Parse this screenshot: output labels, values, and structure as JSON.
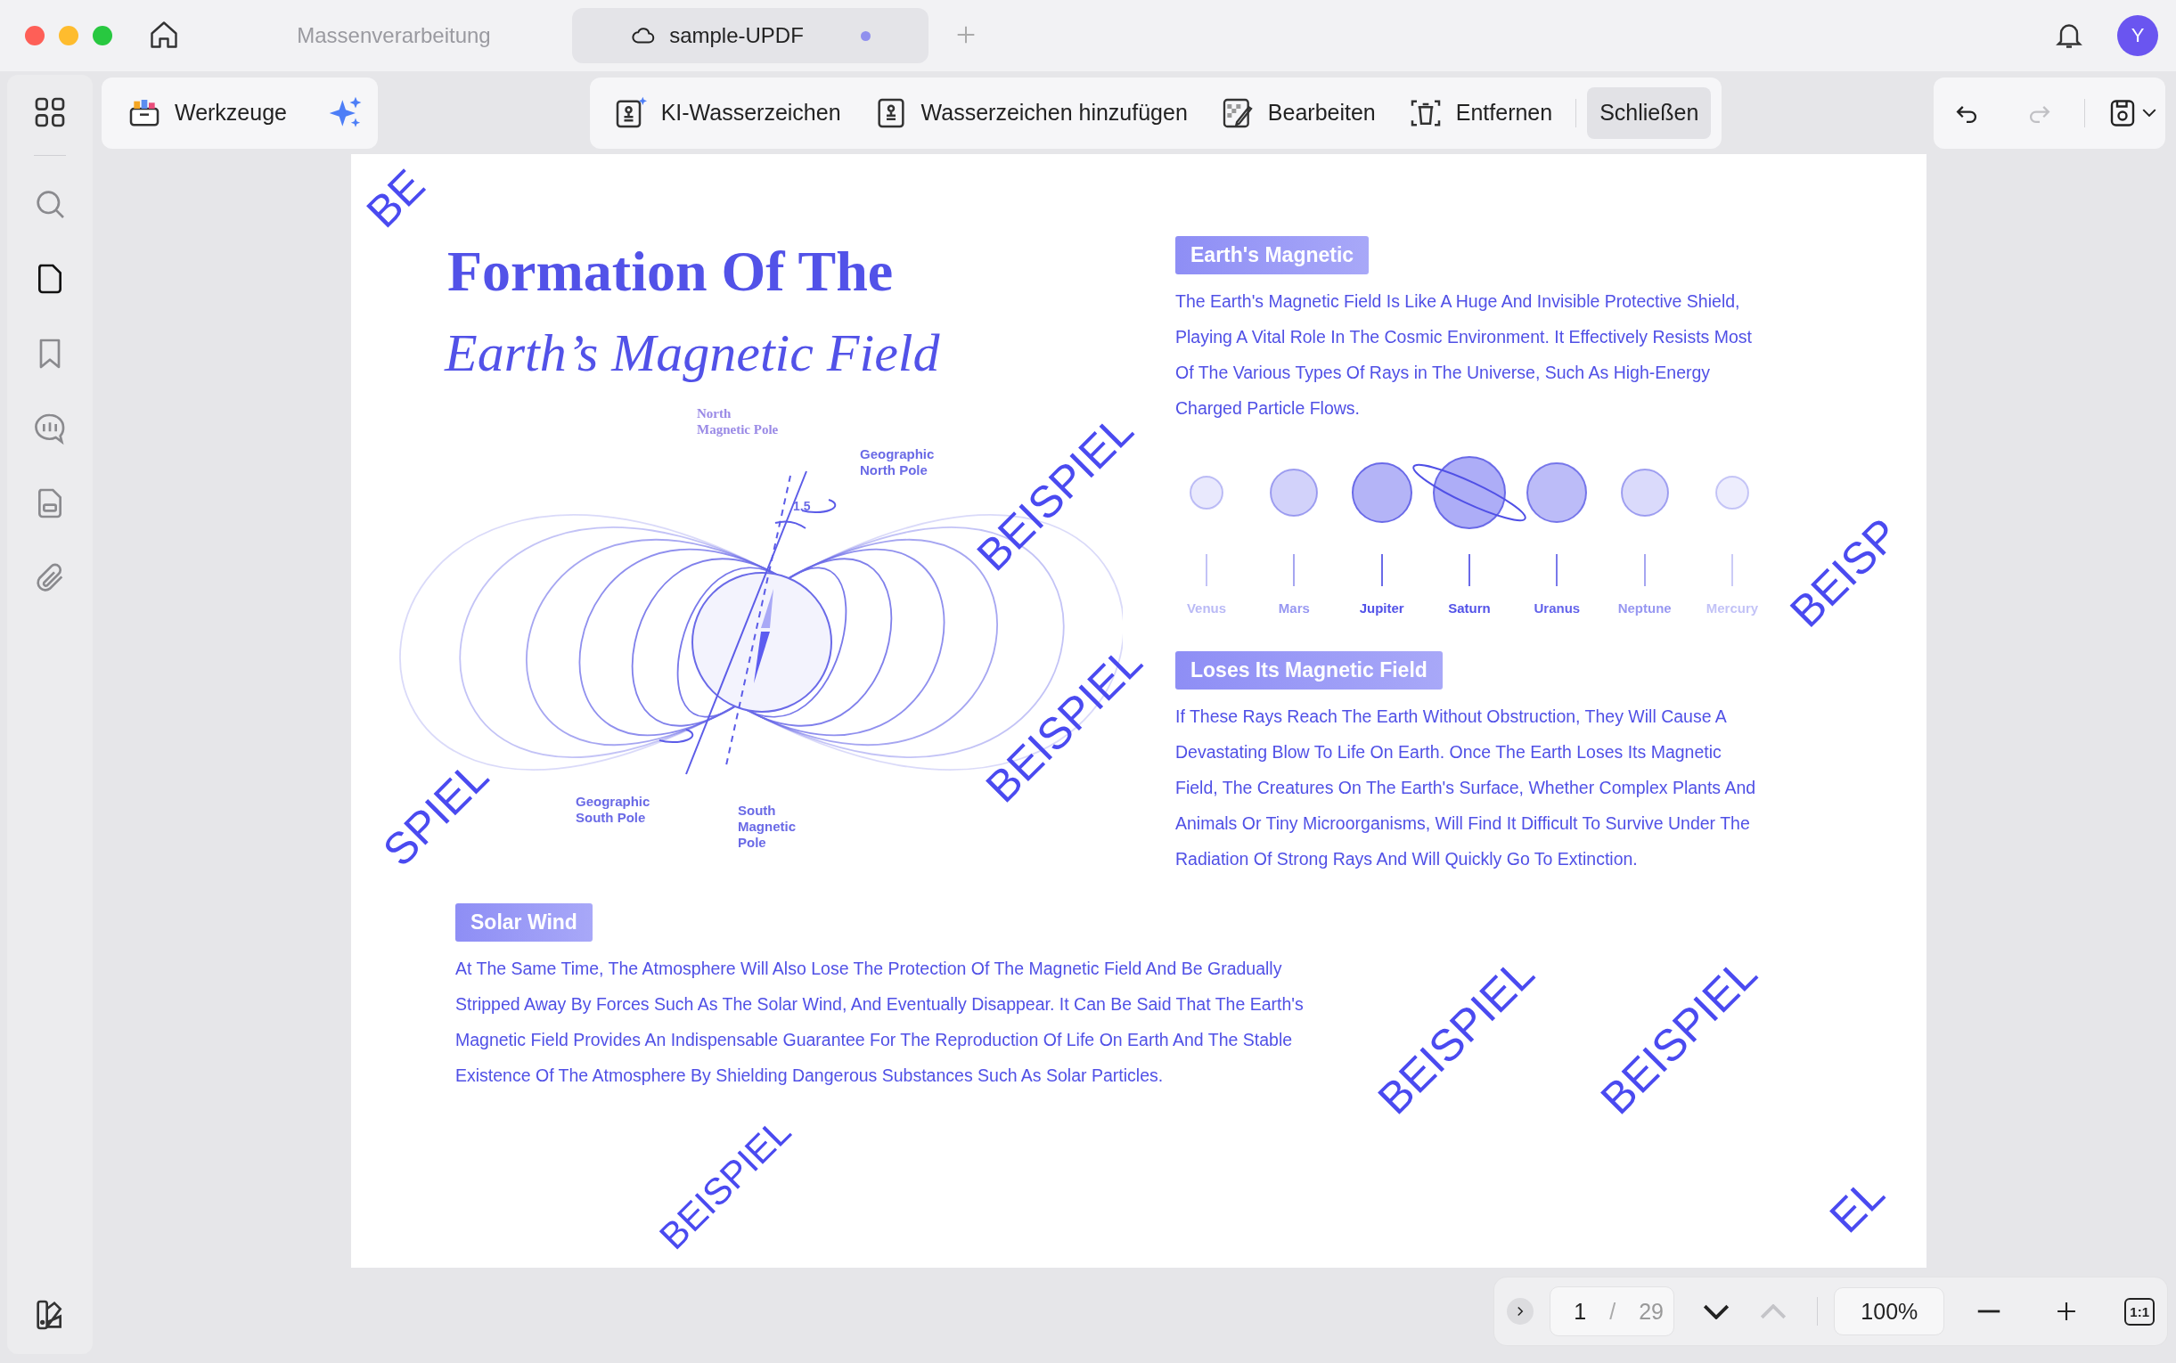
{
  "tabs": [
    {
      "label": "Massenverarbeitung",
      "selected": false,
      "modified": false
    },
    {
      "label": "sample-UPDF",
      "selected": true,
      "modified": true
    }
  ],
  "avatar": "Y",
  "tools": {
    "label": "Werkzeuge"
  },
  "watermark_toolbar": [
    {
      "label": "KI-Wasserzeichen",
      "selected": false
    },
    {
      "label": "Wasserzeichen hinzufügen",
      "selected": false
    },
    {
      "label": "Bearbeiten",
      "selected": false
    },
    {
      "label": "Entfernen",
      "selected": false
    },
    {
      "label": "Schließen",
      "selected": true
    }
  ],
  "history": {
    "undo_disabled": false,
    "redo_disabled": true
  },
  "sidebar": [
    {
      "selected": false
    },
    {
      "selected": true
    },
    {
      "selected": false
    },
    {
      "selected": false
    },
    {
      "selected": false
    },
    {
      "selected": false
    }
  ],
  "document": {
    "title_line1": "Formation Of The",
    "title_line2": "Earth’s Magnetic Field",
    "diagram_labels": {
      "north_magnetic_pole": "North Magnetic Pole",
      "geographic_north_pole": "Geographic North Pole",
      "angle": "1.5",
      "geographic_south_pole": "Geographic South Pole",
      "south_magnetic_pole": "South Magnetic Pole"
    },
    "sections": [
      {
        "heading": "Earth's Magnetic",
        "text": "The Earth's Magnetic Field Is Like A Huge And Invisible Protective Shield, Playing A Vital Role In The Cosmic Environment. It Effectively Resists Most Of The Various Types Of Rays in The Universe, Such As High-Energy Charged Particle Flows."
      },
      {
        "heading": "Loses Its Magnetic Field",
        "text": "If These Rays Reach The Earth Without Obstruction, They Will Cause A Devastating Blow To Life On Earth. Once The Earth Loses Its Magnetic Field, The Creatures On The Earth's Surface, Whether Complex Plants And Animals Or Tiny Microorganisms, Will Find It Difficult To Survive Under The Radiation Of Strong Rays And Will Quickly Go To Extinction."
      },
      {
        "heading": "Solar Wind",
        "text": "At The Same Time, The Atmosphere Will Also Lose The Protection Of The Magnetic Field And Be Gradually Stripped Away By Forces Such As The Solar Wind, And Eventually Disappear. It Can Be Said That The Earth's Magnetic Field Provides An Indispensable Guarantee For The Reproduction Of Life On Earth And The Stable Existence Of The Atmosphere By Shielding Dangerous Substances Such As Solar Particles."
      }
    ],
    "planets": [
      {
        "name": "Venus",
        "kind": "plain"
      },
      {
        "name": "Mars",
        "kind": "plain"
      },
      {
        "name": "Jupiter",
        "kind": "plain"
      },
      {
        "name": "Saturn",
        "kind": "ringed"
      },
      {
        "name": "Uranus",
        "kind": "plain"
      },
      {
        "name": "Neptune",
        "kind": "plain"
      },
      {
        "name": "Mercury",
        "kind": "plain"
      }
    ],
    "watermarks": [
      "BE",
      "BEISPIEL",
      "BEISPIEL",
      "BEISP",
      "SPIEL",
      "BEISPIEL",
      "BEISPIEL",
      "BEISPIEL",
      "EL"
    ]
  },
  "page_nav": {
    "page": "1",
    "separator": "/",
    "total": "29",
    "zoom": "100%",
    "fit": "1:1",
    "prev_disabled": true
  }
}
